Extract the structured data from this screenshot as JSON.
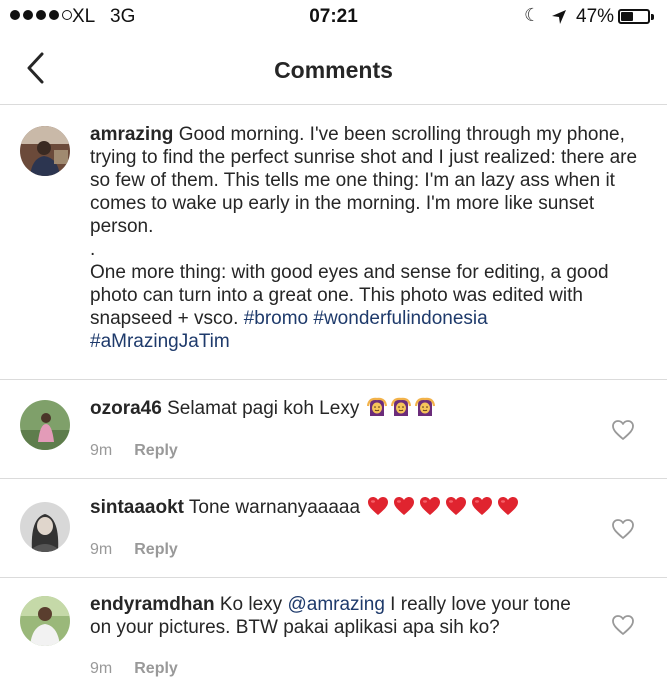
{
  "status_bar": {
    "carrier": "XL",
    "network": "3G",
    "time": "07:21",
    "battery_percent": "47%",
    "battery_level": 0.47,
    "signal_bars_filled": 4,
    "signal_bars_total": 5
  },
  "nav": {
    "title": "Comments",
    "back_icon": "chevron-left-icon"
  },
  "caption": {
    "username": "amrazing",
    "text_lines": [
      " Good morning. I've been scrolling through my phone, trying to find the perfect sunrise shot and I just realized: there are so few of them. This tells me one thing: I'm an lazy ass when it comes to wake up early in the morning. I'm more like sunset person.\n.\nOne more thing: with good eyes and sense for editing, a good photo can turn into a great one. This photo was edited with snapseed + vsco. "
    ],
    "hashtags": [
      "#bromo",
      "#wonderfulindonesia",
      "#aMrazingJaTim"
    ]
  },
  "comments": [
    {
      "username": "ozora46",
      "text": "Selamat pagi koh Lexy",
      "emoji": "woman-gesturing-ok",
      "emoji_count": 3,
      "time": "9m",
      "reply_label": "Reply"
    },
    {
      "username": "sintaaaokt",
      "text": "Tone warnanyaaaaa",
      "emoji": "red-heart",
      "emoji_count": 6,
      "time": "9m",
      "reply_label": "Reply"
    },
    {
      "username": "endyramdhan",
      "text_before_mention": "Ko lexy ",
      "mention": "@amrazing",
      "text_after_mention": "  I really love your tone on your pictures. BTW pakai aplikasi apa sih ko?",
      "time": "9m",
      "reply_label": "Reply"
    }
  ],
  "colors": {
    "link": "#1e3a6b",
    "meta": "#999999",
    "divider": "#dbdbdb"
  }
}
